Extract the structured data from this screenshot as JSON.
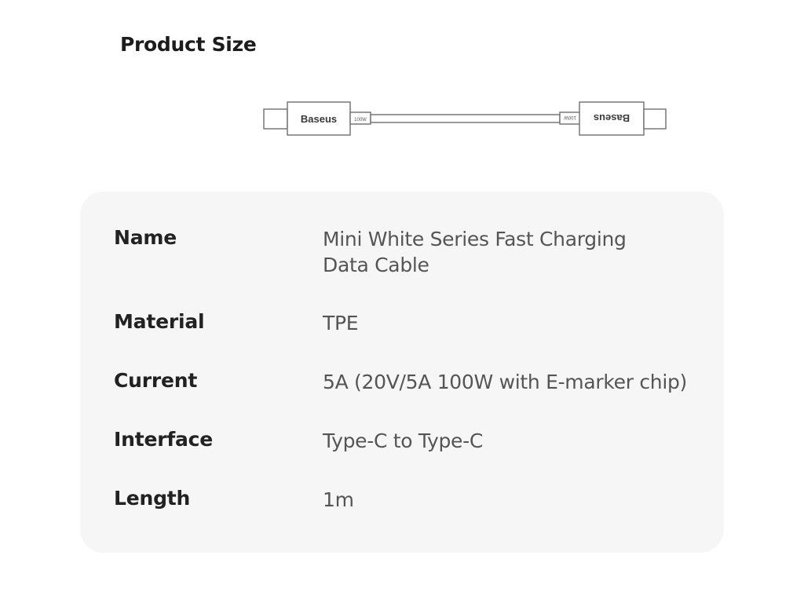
{
  "title": "Product Size",
  "diagram": {
    "brand_left": "Baseus",
    "brand_right": "Baseus",
    "power_label_left": "100W",
    "power_label_right": "100W"
  },
  "specs": [
    {
      "label": "Name",
      "value_lines": [
        "Mini White Series Fast Charging",
        "Data Cable"
      ]
    },
    {
      "label": "Material",
      "value_lines": [
        "TPE"
      ]
    },
    {
      "label": "Current",
      "value_lines": [
        "5A (20V/5A 100W with E-marker chip)"
      ]
    },
    {
      "label": "Interface",
      "value_lines": [
        "Type-C to Type-C"
      ]
    },
    {
      "label": "Length",
      "value_lines": [
        "1m"
      ]
    }
  ]
}
